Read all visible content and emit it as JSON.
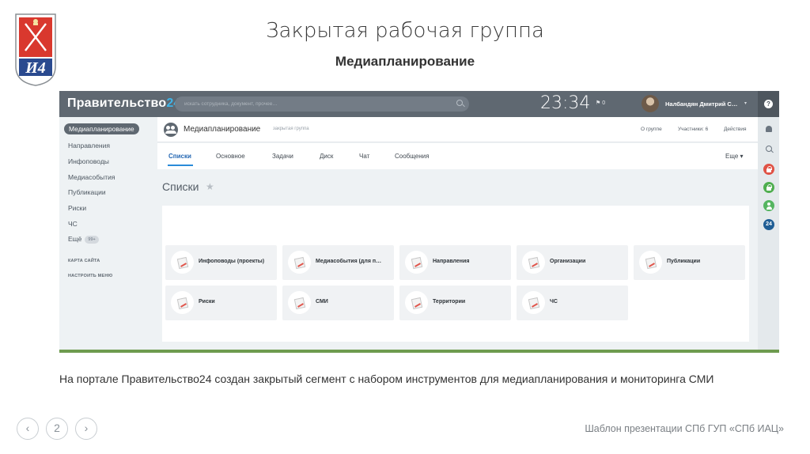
{
  "slide": {
    "title": "Закрытая рабочая группа",
    "subtitle": "Медиапланирование",
    "caption": "На портале Правительство24 создан закрытый сегмент с набором инструментов для медиапланирования и мониторинга СМИ",
    "footer": "Шаблон презентации СПб ГУП «СПб ИАЦ»",
    "page_number": "2",
    "nav_prev": "‹",
    "nav_next": "›"
  },
  "portal": {
    "brand_prefix": "Правительство",
    "brand_number": "24",
    "search_placeholder": "искать сотрудника, документ, прочее…",
    "clock": "23:34",
    "flag_count": "0",
    "user_name": "Налбандян Дмитрий С…",
    "help": "?"
  },
  "sidebar": {
    "items": [
      {
        "label": "Медиапланирование"
      },
      {
        "label": "Направления"
      },
      {
        "label": "Инфоповоды"
      },
      {
        "label": "Медиасобытия"
      },
      {
        "label": "Публикации"
      },
      {
        "label": "Риски"
      },
      {
        "label": "ЧС"
      },
      {
        "label": "Ещё"
      }
    ],
    "more_badge": "99+",
    "sitemap": "КАРТА САЙТА",
    "settings": "НАСТРОИТЬ МЕНЮ"
  },
  "rightbar": {
    "badge_24": "24"
  },
  "group": {
    "name": "Медиапланирование",
    "kind": "закрытая группа",
    "about": "О группе",
    "members": "Участники: 6",
    "actions": "Действия"
  },
  "tabs": {
    "items": [
      "Списки",
      "Основное",
      "Задачи",
      "Диск",
      "Чат",
      "Сообщения"
    ],
    "more": "Еще"
  },
  "lists": {
    "title": "Списки",
    "star": "★",
    "tiles": [
      "Инфоповоды (проекты)",
      "Медиасобытия (для п…",
      "Направления",
      "Организации",
      "Публикации",
      "Риски",
      "СМИ",
      "Территории",
      "ЧС"
    ]
  },
  "colors": {
    "topbar": "#5f6871",
    "accent": "#2a8bd9",
    "border_green": "#6e9b4f",
    "logo_red": "#d9382e",
    "logo_blue": "#2a4a8f"
  }
}
